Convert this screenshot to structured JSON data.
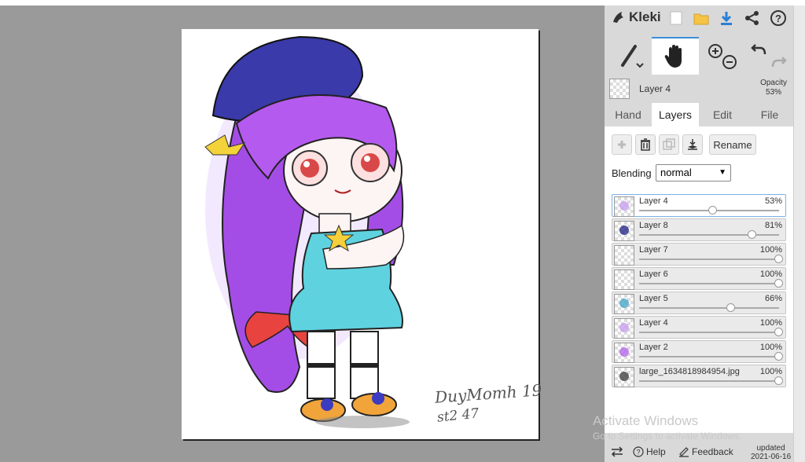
{
  "app": {
    "name": "Kleki"
  },
  "current_layer": {
    "name": "Layer 4",
    "opacity_label": "Opacity",
    "opacity_value": "53%"
  },
  "tabs": [
    {
      "label": "Hand"
    },
    {
      "label": "Layers"
    },
    {
      "label": "Edit"
    },
    {
      "label": "File"
    }
  ],
  "layer_actions": {
    "rename_label": "Rename"
  },
  "blending": {
    "label": "Blending",
    "value": "normal"
  },
  "layers": [
    {
      "name": "Layer 4",
      "opacity": "53%",
      "level": 0.53,
      "selected": true
    },
    {
      "name": "Layer 8",
      "opacity": "81%",
      "level": 0.81
    },
    {
      "name": "Layer 7",
      "opacity": "100%",
      "level": 1.0
    },
    {
      "name": "Layer 6",
      "opacity": "100%",
      "level": 1.0
    },
    {
      "name": "Layer 5",
      "opacity": "66%",
      "level": 0.66
    },
    {
      "name": "Layer 4",
      "opacity": "100%",
      "level": 1.0
    },
    {
      "name": "Layer 2",
      "opacity": "100%",
      "level": 1.0
    },
    {
      "name": "large_1634818984954.jpg",
      "opacity": "100%",
      "level": 1.0
    }
  ],
  "footer": {
    "help_label": "Help",
    "feedback_label": "Feedback",
    "updated_label": "updated",
    "updated_date": "2021-06-16"
  },
  "watermark": {
    "line1": "Activate Windows",
    "line2": "Go to Settings to activate Windows."
  },
  "artwork": {
    "signature_line1": "DuyMomh 19",
    "signature_line2": "st2 47"
  },
  "colors": {
    "accent": "#3b8ed6",
    "panel_bg": "#d9d9d9",
    "canvas_bg": "#9a9a9a"
  }
}
